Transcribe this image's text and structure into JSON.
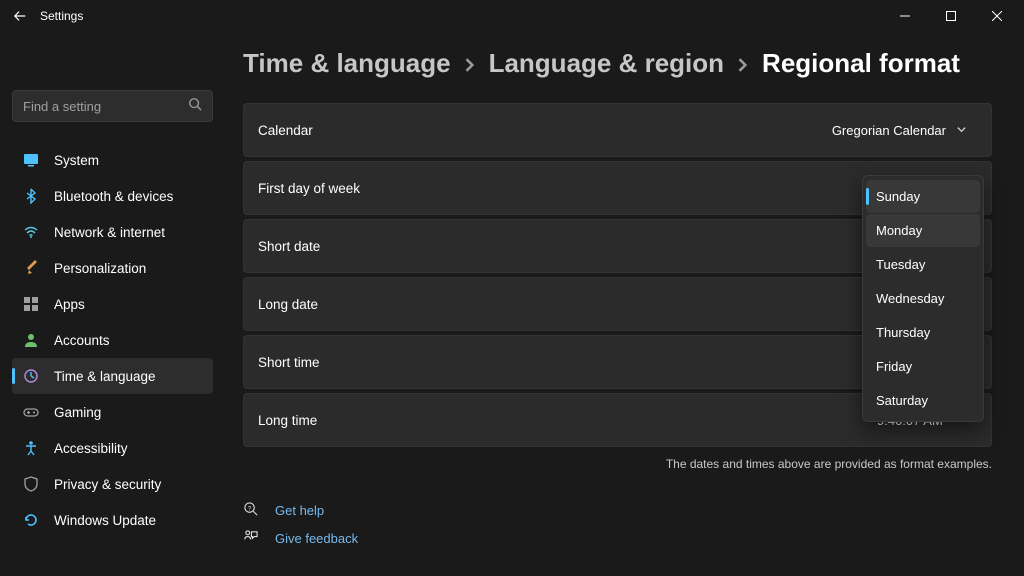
{
  "titlebar": {
    "title": "Settings"
  },
  "search": {
    "placeholder": "Find a setting"
  },
  "sidebar": {
    "items": [
      {
        "label": "System"
      },
      {
        "label": "Bluetooth & devices"
      },
      {
        "label": "Network & internet"
      },
      {
        "label": "Personalization"
      },
      {
        "label": "Apps"
      },
      {
        "label": "Accounts"
      },
      {
        "label": "Time & language"
      },
      {
        "label": "Gaming"
      },
      {
        "label": "Accessibility"
      },
      {
        "label": "Privacy & security"
      },
      {
        "label": "Windows Update"
      }
    ]
  },
  "breadcrumb": {
    "root": "Time & language",
    "mid": "Language & region",
    "current": "Regional format"
  },
  "rows": {
    "calendar": {
      "label": "Calendar",
      "value": "Gregorian Calendar"
    },
    "firstday": {
      "label": "First day of week"
    },
    "shortdate": {
      "label": "Short date"
    },
    "longdate": {
      "label": "Long date"
    },
    "shorttime": {
      "label": "Short time"
    },
    "longtime": {
      "label": "Long time",
      "value": "9:40:07 AM"
    }
  },
  "flyout": {
    "options": [
      "Sunday",
      "Monday",
      "Tuesday",
      "Wednesday",
      "Thursday",
      "Friday",
      "Saturday"
    ],
    "selected": "Sunday",
    "hovered": "Monday"
  },
  "footnote": "The dates and times above are provided as format examples.",
  "links": {
    "help": "Get help",
    "feedback": "Give feedback"
  }
}
